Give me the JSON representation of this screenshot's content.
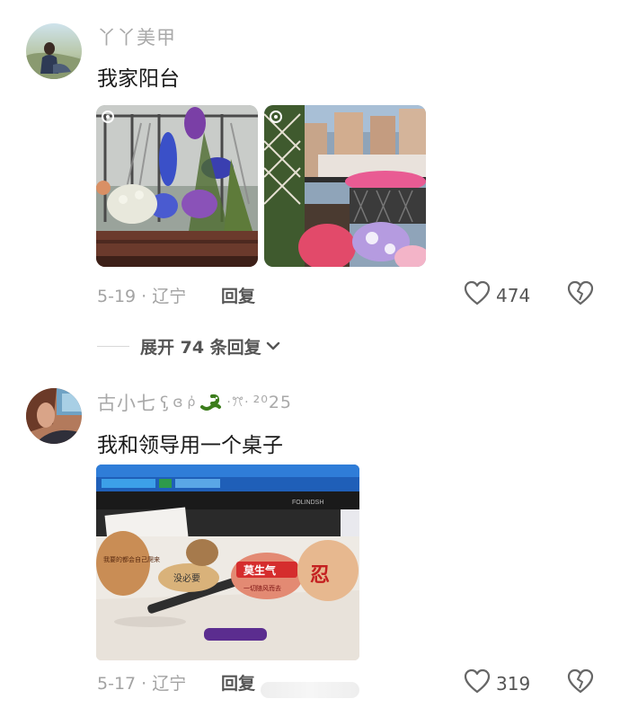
{
  "comments": [
    {
      "username": "丫丫美甲",
      "text": "我家阳台",
      "date_location": "5-19 · 辽宁",
      "reply_label": "回复",
      "likes": "474",
      "expand_label": "展开 74 条回复"
    },
    {
      "username": "古小七",
      "username_deco": "ʕ̡̢̡ ◌̈ ⚲ 🐍 ·ꔫ·",
      "username_year": "²⁰25",
      "text": "我和领导用一个桌子",
      "date_location": "5-17 · 辽宁",
      "reply_label": "回复",
      "likes": "319",
      "desk_stickers": {
        "sticker_a": "我要的都会自己爬来",
        "sticker_b": "没必要",
        "sticker_c": "莫生气",
        "sticker_c_sub": "一切随风而去",
        "sticker_d": "忍"
      },
      "monitor_brand": "FOLINDSH"
    }
  ],
  "colors": {
    "heart": "#666666",
    "meta": "#a3a3a3"
  }
}
